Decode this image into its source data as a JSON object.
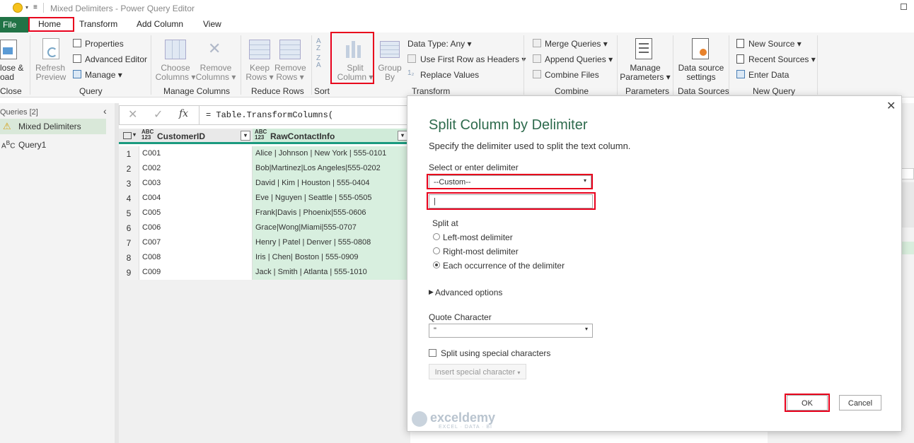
{
  "window": {
    "title": "Mixed Delimiters - Power Query Editor"
  },
  "tabs": [
    {
      "label": "File"
    },
    {
      "label": "Home"
    },
    {
      "label": "Transform"
    },
    {
      "label": "Add Column"
    },
    {
      "label": "View"
    }
  ],
  "ribbon": {
    "close_load": "lose &",
    "close_load2": "oad",
    "close_group": "Close",
    "refresh": "Refresh",
    "refresh2": "Preview",
    "properties": "Properties",
    "advanced_editor": "Advanced Editor",
    "manage": "Manage",
    "query_group": "Query",
    "choose_columns": "Choose",
    "choose_columns2": "Columns",
    "remove_columns": "Remove",
    "remove_columns2": "Columns",
    "manage_columns_group": "Manage Columns",
    "keep_rows": "Keep",
    "keep_rows2": "Rows",
    "remove_rows": "Remove",
    "remove_rows2": "Rows",
    "reduce_rows_group": "Reduce Rows",
    "sort_group": "Sort",
    "split_column": "Split",
    "split_column2": "Column",
    "group_by": "Group",
    "group_by2": "By",
    "data_type": "Data Type: Any",
    "use_first_row": "Use First Row as Headers",
    "replace_values": "Replace Values",
    "transform_group": "Transform",
    "merge_queries": "Merge Queries",
    "append_queries": "Append Queries",
    "combine_files": "Combine Files",
    "combine_group": "Combine",
    "manage_parameters": "Manage",
    "manage_parameters2": "Parameters",
    "parameters_group": "Parameters",
    "data_source_settings": "Data source",
    "data_source_settings2": "settings",
    "data_sources_group": "Data Sources",
    "new_source": "New Source",
    "recent_sources": "Recent Sources",
    "enter_data": "Enter Data",
    "new_query_group": "New Query"
  },
  "queries": {
    "header": "Queries [2]",
    "items": [
      {
        "label": "Mixed Delimiters"
      },
      {
        "label": "Query1"
      }
    ]
  },
  "formula": {
    "text": "= Table.TransformColumns("
  },
  "grid": {
    "columns": [
      {
        "type": "ABC\n123",
        "label": "CustomerID"
      },
      {
        "type": "ABC\n123",
        "label": "RawContactInfo"
      }
    ],
    "rows": [
      {
        "n": "1",
        "id": "C001",
        "info": "Alice | Johnson | New York | 555-0101"
      },
      {
        "n": "2",
        "id": "C002",
        "info": "Bob|Martinez|Los Angeles|555-0202"
      },
      {
        "n": "3",
        "id": "C003",
        "info": "David | Kim | Houston | 555-0404"
      },
      {
        "n": "4",
        "id": "C004",
        "info": "Eve | Nguyen | Seattle | 555-0505"
      },
      {
        "n": "5",
        "id": "C005",
        "info": "Frank|Davis | Phoenix|555-0606"
      },
      {
        "n": "6",
        "id": "C006",
        "info": "Grace|Wong|Miami|555-0707"
      },
      {
        "n": "7",
        "id": "C007",
        "info": "Henry | Patel | Denver | 555-0808"
      },
      {
        "n": "8",
        "id": "C008",
        "info": "Iris | Chen| Boston | 555-0909"
      },
      {
        "n": "9",
        "id": "C009",
        "info": "Jack | Smith | Atlanta | 555-1010"
      }
    ]
  },
  "dialog": {
    "title": "Split Column by Delimiter",
    "subtitle": "Specify the delimiter used to split the text column.",
    "delimiter_label": "Select or enter delimiter",
    "delimiter_value": "--Custom--",
    "custom_value": "|",
    "split_at_label": "Split at",
    "options": [
      "Left-most delimiter",
      "Right-most delimiter",
      "Each occurrence of the delimiter"
    ],
    "selected_option": "Each occurrence of the delimiter",
    "advanced": "Advanced options",
    "quote_label": "Quote Character",
    "quote_value": "\"",
    "special_chars": "Split using special characters",
    "insert_special": "Insert special character",
    "ok": "OK",
    "cancel": "Cancel"
  },
  "watermark": {
    "brand": "exceldemy",
    "tagline": "EXCEL · DATA · BI"
  },
  "colors": {
    "accent": "#217346",
    "highlight": "#e8001c",
    "grid_accent": "#1b9a7f",
    "column_fill": "#d8efdf"
  }
}
